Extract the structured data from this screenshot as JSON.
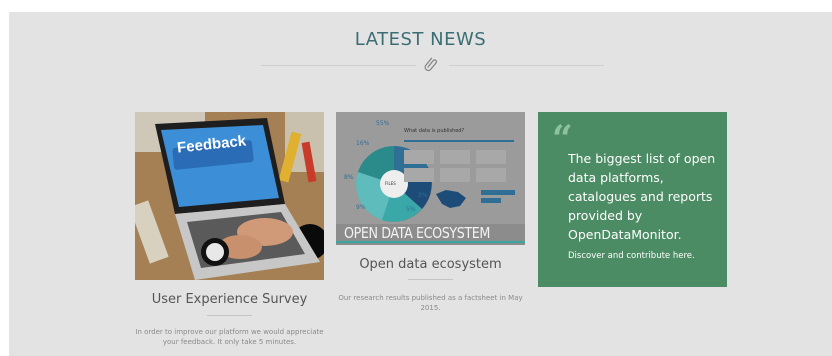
{
  "section": {
    "title": "LATEST NEWS",
    "icon": "paperclip-icon"
  },
  "cards": [
    {
      "image_text": "Feedback",
      "title": "User Experience Survey",
      "description": "In order to improve our platform we would appreciate your feedback. It only take 5 minutes."
    },
    {
      "image_caption": "OPEN DATA ECOSYSTEM",
      "infographic_heading": "What data is published?",
      "infographic_percentages": [
        "55%",
        "16%",
        "8%",
        "9%",
        "2%",
        "5%"
      ],
      "infographic_center": "FILES",
      "title": "Open data ecosystem",
      "description": "Our research results published as a factsheet in May 2015."
    }
  ],
  "promo": {
    "text": "The biggest list of open data platforms, catalogues and reports provided by OpenDataMonitor.",
    "link": "Discover and contribute here."
  },
  "colors": {
    "title": "#3a6e74",
    "promo_bg": "#4c8c64",
    "panel_bg": "#e3e3e3"
  }
}
